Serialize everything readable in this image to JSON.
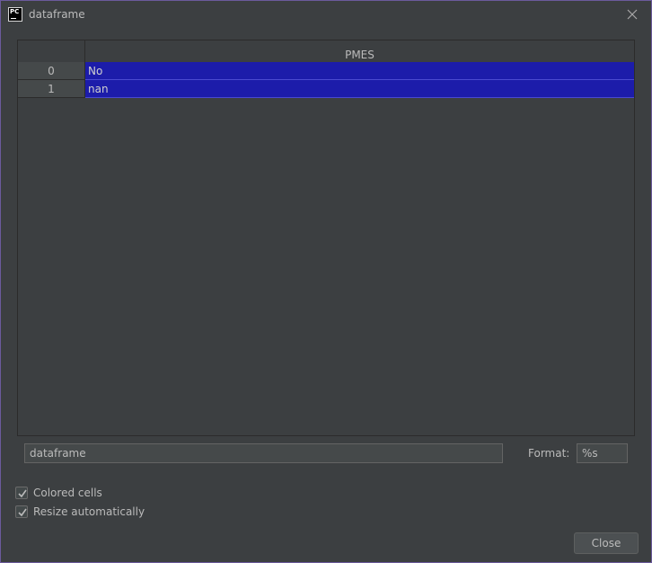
{
  "window": {
    "title": "dataframe",
    "app_icon_text": "PC",
    "border_color": "#6b5a9c"
  },
  "table": {
    "column_header": "PMES",
    "rows": [
      {
        "index": "0",
        "value": "No"
      },
      {
        "index": "1",
        "value": "nan"
      }
    ],
    "selection_color": "#1c1caa"
  },
  "expression": {
    "value": "dataframe"
  },
  "format": {
    "label": "Format:",
    "value": "%s"
  },
  "options": {
    "colored_cells": {
      "label": "Colored cells",
      "checked": true
    },
    "resize_automatically": {
      "label": "Resize automatically",
      "checked": true
    }
  },
  "buttons": {
    "close_label": "Close"
  }
}
